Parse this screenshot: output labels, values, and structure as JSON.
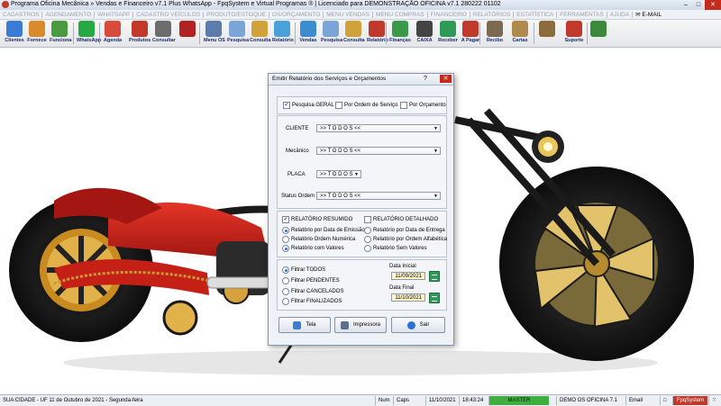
{
  "window": {
    "title": "Programa Oficina Mecânica » Vendas e Financeiro v7.1 Plus WhatsApp - FpqSystem e Virtual Programas ® | Licenciado para  DEMONSTRAÇÃO OFICINA v7.1 280222 01102"
  },
  "menu": {
    "items": [
      "CADASTROS",
      "AGENDAMENTO",
      "WHATSAPP",
      "CADASTRO VEÍCULOS",
      "PRODUTO/ESTOQUE",
      "OS/ORÇAMENTO",
      "MENU VENDAS",
      "MENU COMPRAS",
      "FINANCEIRO",
      "RELATÓRIOS",
      "ESTATÍSTICA",
      "FERRAMENTAS",
      "AJUDA"
    ],
    "email": "E-MAIL"
  },
  "toolbar": {
    "buttons": [
      {
        "label": "Clientes",
        "color": "#3a7bd5"
      },
      {
        "label": "Fornece",
        "color": "#d98b2b"
      },
      {
        "label": "Funciona",
        "color": "#4a9b3f"
      },
      {
        "label": "WhatsApp",
        "color": "#25a944"
      },
      {
        "label": "Agenda",
        "color": "#d94b3a"
      },
      {
        "label": "Produtos",
        "color": "#c0392b"
      },
      {
        "label": "Consultar",
        "color": "#6d6d6d"
      },
      {
        "label": "",
        "color": "#b22222"
      },
      {
        "label": "Menu OS",
        "color": "#5c7cab"
      },
      {
        "label": "Pesquisa",
        "color": "#7aa5d6"
      },
      {
        "label": "Consulta",
        "color": "#d2a23a"
      },
      {
        "label": "Relatório",
        "color": "#4aa0d8"
      },
      {
        "label": "Vendas",
        "color": "#3c8dd0"
      },
      {
        "label": "Pesquisa",
        "color": "#7aa5d6"
      },
      {
        "label": "Consulta",
        "color": "#d2a23a"
      },
      {
        "label": "Relatório",
        "color": "#c0392b"
      },
      {
        "label": "Finanças",
        "color": "#3b9a4a"
      },
      {
        "label": "CAIXA",
        "color": "#444444"
      },
      {
        "label": "Receber",
        "color": "#2e9a57"
      },
      {
        "label": "A Pagar",
        "color": "#c0392b"
      },
      {
        "label": "Recibo",
        "color": "#7a6a50"
      },
      {
        "label": "Cartas",
        "color": "#b08a4a"
      },
      {
        "label": "",
        "color": "#8a6d3b"
      },
      {
        "label": "Suporte",
        "color": "#c0392b"
      },
      {
        "label": "",
        "color": "#3b8a3b"
      }
    ]
  },
  "dialog": {
    "title": "Emitir Relatório dos Serviços e Orçamentos",
    "search_options": [
      {
        "label": "Pesquisa GERAL",
        "checked": true
      },
      {
        "label": "Por Ordem de Serviço",
        "checked": false
      },
      {
        "label": "Por Orçamento",
        "checked": false
      }
    ],
    "filters": [
      {
        "label": "CLIENTE",
        "value": ">> T O D O S <<"
      },
      {
        "label": "Mecânico",
        "value": ">> T O D O S <<"
      },
      {
        "label": "PLACA",
        "value": ">> T O D O S"
      },
      {
        "label": "Status Ordem",
        "value": ">> T O D O S <<"
      }
    ],
    "report_types": [
      {
        "label": "RELATÓRIO RESUMIDO",
        "checked": true
      },
      {
        "label": "RELATÓRIO DETALHADO",
        "checked": false
      }
    ],
    "sort_left": [
      {
        "label": "Relatório por Data de Emissão",
        "selected": true
      },
      {
        "label": "Relatório Ordem Numérica",
        "selected": false
      },
      {
        "label": "Relatório com Valores",
        "selected": true
      }
    ],
    "sort_right": [
      {
        "label": "Relatório por Data de Entrega",
        "selected": false
      },
      {
        "label": "Relatório por Ordem Alfabética",
        "selected": false
      },
      {
        "label": "Relatório Sem Valores",
        "selected": false
      }
    ],
    "status_filters": [
      {
        "label": "Filtrar TODOS",
        "selected": true
      },
      {
        "label": "Filtrar PENDENTES",
        "selected": false
      },
      {
        "label": "Filtrar CANCELADOS",
        "selected": false
      },
      {
        "label": "Filtrar FINALIZADOS",
        "selected": false
      }
    ],
    "date_start_label": "Data Inicial",
    "date_start": "11/09/2021",
    "date_end_label": "Data Final",
    "date_end": "11/10/2021",
    "buttons": {
      "screen": "Tela",
      "printer": "Impressora",
      "exit": "Sair"
    }
  },
  "status": {
    "city": "SUA CIDADE - UF 11 de Outubro de 2021 - Segunda-feira",
    "num": "Num",
    "caps": "Caps",
    "date": "11/10/2021",
    "time": "18:43:24",
    "mode": "MASTER",
    "demo": "DEMO OS OFICINA 7.1",
    "email": "Email",
    "brand": "FpqSystem"
  },
  "colors": {
    "accent": "#2f6fd1",
    "master": "#3fae3f",
    "brand": "#c0392b"
  }
}
